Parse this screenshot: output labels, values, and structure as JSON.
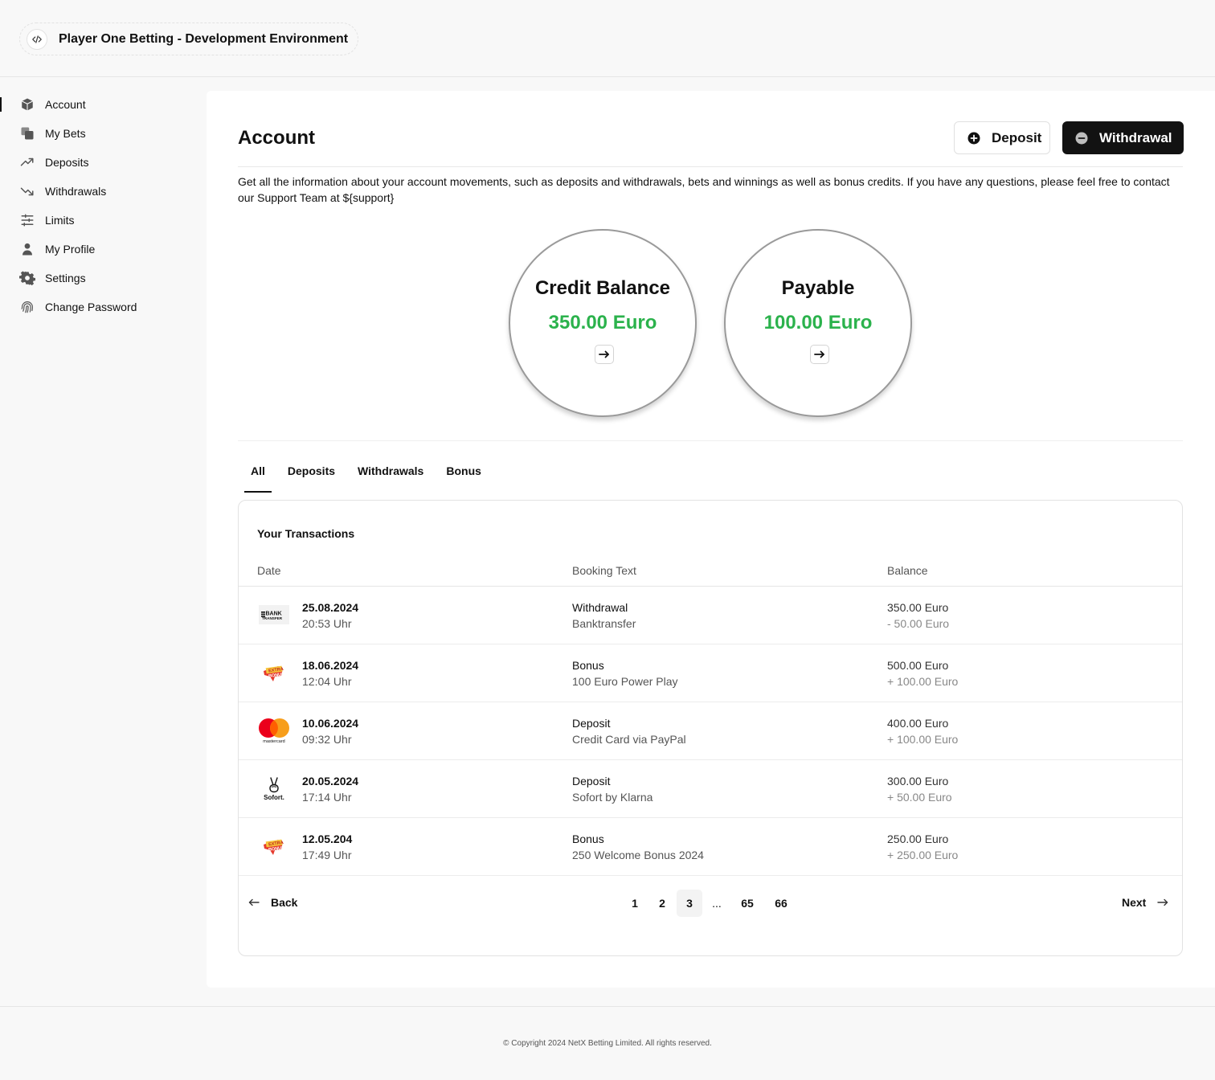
{
  "header": {
    "title": "Player One Betting - Development Environment",
    "icon": "code-icon"
  },
  "sidebar": {
    "items": [
      {
        "label": "Account",
        "icon": "box-icon",
        "active": true
      },
      {
        "label": "My Bets",
        "icon": "copy-icon",
        "active": false
      },
      {
        "label": "Deposits",
        "icon": "trending-up-icon",
        "active": false
      },
      {
        "label": "Withdrawals",
        "icon": "trending-down-icon",
        "active": false
      },
      {
        "label": "Limits",
        "icon": "sliders-icon",
        "active": false
      },
      {
        "label": "My Profile",
        "icon": "user-icon",
        "active": false
      },
      {
        "label": "Settings",
        "icon": "gear-icon",
        "active": false
      },
      {
        "label": "Change Password",
        "icon": "fingerprint-icon",
        "active": false
      }
    ]
  },
  "main": {
    "title": "Account",
    "deposit_label": "Deposit",
    "withdrawal_label": "Withdrawal",
    "intro": "Get all the information about your account movements, such as deposits and withdrawals, bets and winnings as well as bonus credits. If you have any questions, please feel free to contact our Support Team at ${support}",
    "balances": [
      {
        "title": "Credit Balance",
        "amount": "350.00 Euro"
      },
      {
        "title": "Payable",
        "amount": "100.00 Euro"
      }
    ],
    "tabs": [
      {
        "label": "All",
        "active": true
      },
      {
        "label": "Deposits",
        "active": false
      },
      {
        "label": "Withdrawals",
        "active": false
      },
      {
        "label": "Bonus",
        "active": false
      }
    ]
  },
  "transactions": {
    "title": "Your Transactions",
    "columns": {
      "date": "Date",
      "text": "Booking Text",
      "balance": "Balance"
    },
    "rows": [
      {
        "logo": "banktransfer",
        "logo_text": "BANK TRANSFER",
        "date": "25.08.2024",
        "time": "20:53 Uhr",
        "type": "Withdrawal",
        "detail": "Banktransfer",
        "balance": "350.00 Euro",
        "change": "- 50.00 Euro"
      },
      {
        "logo": "extrabonus",
        "logo_text": "EXTRA BONUS",
        "date": "18.06.2024",
        "time": "12:04 Uhr",
        "type": "Bonus",
        "detail": "100 Euro Power Play",
        "balance": "500.00 Euro",
        "change": "+ 100.00 Euro"
      },
      {
        "logo": "mastercard",
        "logo_text": "mastercard",
        "date": "10.06.2024",
        "time": "09:32 Uhr",
        "type": "Deposit",
        "detail": "Credit Card via PayPal",
        "balance": "400.00 Euro",
        "change": "+ 100.00 Euro"
      },
      {
        "logo": "sofort",
        "logo_text": "Sofort.",
        "date": "20.05.2024",
        "time": "17:14 Uhr",
        "type": "Deposit",
        "detail": "Sofort by Klarna",
        "balance": "300.00 Euro",
        "change": "+ 50.00 Euro"
      },
      {
        "logo": "extrabonus",
        "logo_text": "EXTRA BONUS",
        "date": "12.05.204",
        "time": "17:49 Uhr",
        "type": "Bonus",
        "detail": "250 Welcome Bonus 2024",
        "balance": "250.00 Euro",
        "change": "+ 250.00 Euro"
      }
    ]
  },
  "pagination": {
    "back_label": "Back",
    "next_label": "Next",
    "pages": [
      "1",
      "2",
      "3",
      "...",
      "65",
      "66"
    ],
    "current": "3"
  },
  "footer": {
    "copyright": "© Copyright 2024 NetX Betting Limited. All rights reserved."
  },
  "colors": {
    "accent_green": "#2bb24c",
    "primary_dark": "#121212"
  }
}
